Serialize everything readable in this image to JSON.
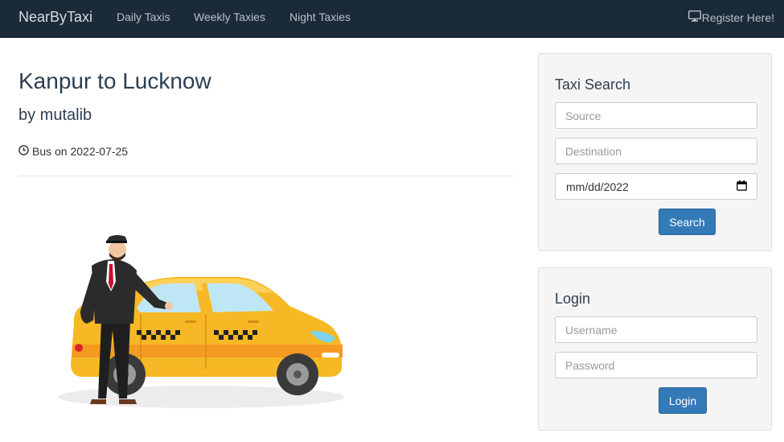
{
  "navbar": {
    "brand": "NearByTaxi",
    "links": [
      "Daily Taxis",
      "Weekly Taxies",
      "Night Taxies"
    ],
    "register_label": "Register Here!",
    "register_icon": "monitor-icon"
  },
  "ride": {
    "title": "Kanpur to Lucknow",
    "subtitle": "by mutalib",
    "meta": "Bus on 2022-07-25",
    "meta_icon": "clock-icon"
  },
  "illustration": {
    "subject": "taxi-driver-with-yellow-taxi",
    "colors": {
      "taxi_body": "#f6b824",
      "taxi_stripe": "#f59a23",
      "suit": "#2b2b2b",
      "tie": "#c8102e"
    }
  },
  "taxi_search": {
    "heading": "Taxi Search",
    "source_placeholder": "Source",
    "destination_placeholder": "Destination",
    "date_value": "mm/dd/2022",
    "calendar_icon": "calendar-icon",
    "search_label": "Search"
  },
  "login": {
    "heading": "Login",
    "username_placeholder": "Username",
    "password_placeholder": "Password",
    "login_label": "Login"
  },
  "colors": {
    "navbar_bg": "#1b2a38",
    "primary_button": "#337ab7",
    "panel_bg": "#f5f5f5",
    "heading_text": "#2c3e50"
  }
}
